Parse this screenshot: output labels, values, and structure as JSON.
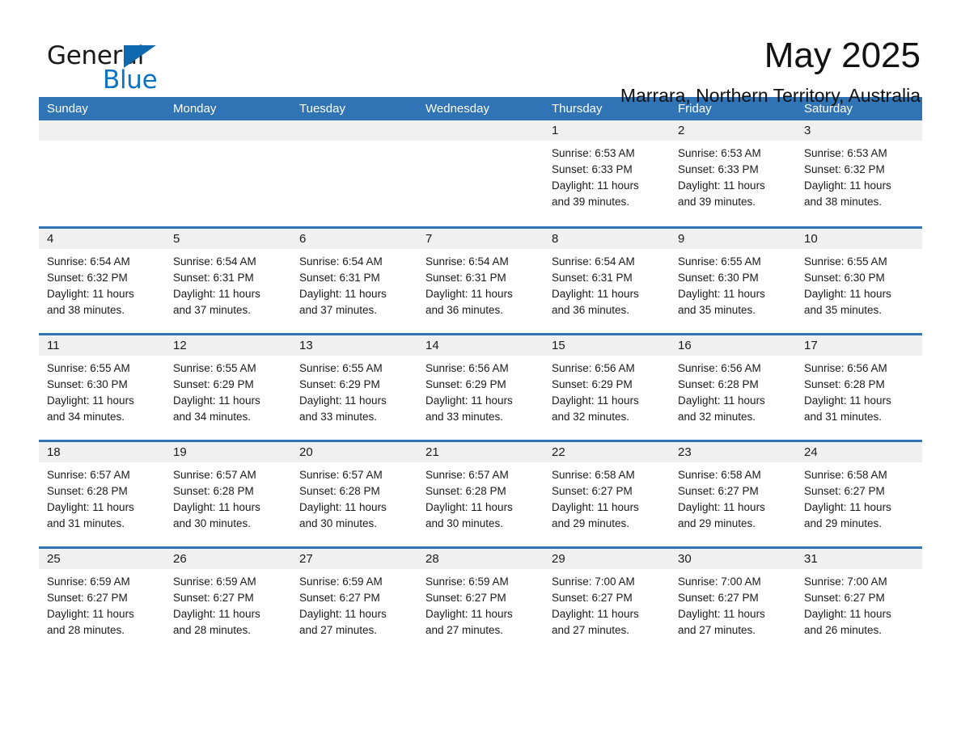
{
  "brand": {
    "name_part1": "General",
    "name_part2": "Blue",
    "triangle_icon": "brand-triangle-icon",
    "accent_color": "#1069ae",
    "blue_text_color": "#0b72c4"
  },
  "header": {
    "month_title": "May 2025",
    "location": "Marrara, Northern Territory, Australia",
    "header_bar_color": "#3174b6",
    "day_number_band_color": "#f0f0f0"
  },
  "weekdays": [
    "Sunday",
    "Monday",
    "Tuesday",
    "Wednesday",
    "Thursday",
    "Friday",
    "Saturday"
  ],
  "labels": {
    "sunrise_prefix": "Sunrise:",
    "sunset_prefix": "Sunset:",
    "daylight_prefix": "Daylight:"
  },
  "weeks": [
    [
      {
        "day": "",
        "empty": true
      },
      {
        "day": "",
        "empty": true
      },
      {
        "day": "",
        "empty": true
      },
      {
        "day": "",
        "empty": true
      },
      {
        "day": "1",
        "sunrise": "Sunrise: 6:53 AM",
        "sunset": "Sunset: 6:33 PM",
        "daylight_l1": "Daylight: 11 hours",
        "daylight_l2": "and 39 minutes."
      },
      {
        "day": "2",
        "sunrise": "Sunrise: 6:53 AM",
        "sunset": "Sunset: 6:33 PM",
        "daylight_l1": "Daylight: 11 hours",
        "daylight_l2": "and 39 minutes."
      },
      {
        "day": "3",
        "sunrise": "Sunrise: 6:53 AM",
        "sunset": "Sunset: 6:32 PM",
        "daylight_l1": "Daylight: 11 hours",
        "daylight_l2": "and 38 minutes."
      }
    ],
    [
      {
        "day": "4",
        "sunrise": "Sunrise: 6:54 AM",
        "sunset": "Sunset: 6:32 PM",
        "daylight_l1": "Daylight: 11 hours",
        "daylight_l2": "and 38 minutes."
      },
      {
        "day": "5",
        "sunrise": "Sunrise: 6:54 AM",
        "sunset": "Sunset: 6:31 PM",
        "daylight_l1": "Daylight: 11 hours",
        "daylight_l2": "and 37 minutes."
      },
      {
        "day": "6",
        "sunrise": "Sunrise: 6:54 AM",
        "sunset": "Sunset: 6:31 PM",
        "daylight_l1": "Daylight: 11 hours",
        "daylight_l2": "and 37 minutes."
      },
      {
        "day": "7",
        "sunrise": "Sunrise: 6:54 AM",
        "sunset": "Sunset: 6:31 PM",
        "daylight_l1": "Daylight: 11 hours",
        "daylight_l2": "and 36 minutes."
      },
      {
        "day": "8",
        "sunrise": "Sunrise: 6:54 AM",
        "sunset": "Sunset: 6:31 PM",
        "daylight_l1": "Daylight: 11 hours",
        "daylight_l2": "and 36 minutes."
      },
      {
        "day": "9",
        "sunrise": "Sunrise: 6:55 AM",
        "sunset": "Sunset: 6:30 PM",
        "daylight_l1": "Daylight: 11 hours",
        "daylight_l2": "and 35 minutes."
      },
      {
        "day": "10",
        "sunrise": "Sunrise: 6:55 AM",
        "sunset": "Sunset: 6:30 PM",
        "daylight_l1": "Daylight: 11 hours",
        "daylight_l2": "and 35 minutes."
      }
    ],
    [
      {
        "day": "11",
        "sunrise": "Sunrise: 6:55 AM",
        "sunset": "Sunset: 6:30 PM",
        "daylight_l1": "Daylight: 11 hours",
        "daylight_l2": "and 34 minutes."
      },
      {
        "day": "12",
        "sunrise": "Sunrise: 6:55 AM",
        "sunset": "Sunset: 6:29 PM",
        "daylight_l1": "Daylight: 11 hours",
        "daylight_l2": "and 34 minutes."
      },
      {
        "day": "13",
        "sunrise": "Sunrise: 6:55 AM",
        "sunset": "Sunset: 6:29 PM",
        "daylight_l1": "Daylight: 11 hours",
        "daylight_l2": "and 33 minutes."
      },
      {
        "day": "14",
        "sunrise": "Sunrise: 6:56 AM",
        "sunset": "Sunset: 6:29 PM",
        "daylight_l1": "Daylight: 11 hours",
        "daylight_l2": "and 33 minutes."
      },
      {
        "day": "15",
        "sunrise": "Sunrise: 6:56 AM",
        "sunset": "Sunset: 6:29 PM",
        "daylight_l1": "Daylight: 11 hours",
        "daylight_l2": "and 32 minutes."
      },
      {
        "day": "16",
        "sunrise": "Sunrise: 6:56 AM",
        "sunset": "Sunset: 6:28 PM",
        "daylight_l1": "Daylight: 11 hours",
        "daylight_l2": "and 32 minutes."
      },
      {
        "day": "17",
        "sunrise": "Sunrise: 6:56 AM",
        "sunset": "Sunset: 6:28 PM",
        "daylight_l1": "Daylight: 11 hours",
        "daylight_l2": "and 31 minutes."
      }
    ],
    [
      {
        "day": "18",
        "sunrise": "Sunrise: 6:57 AM",
        "sunset": "Sunset: 6:28 PM",
        "daylight_l1": "Daylight: 11 hours",
        "daylight_l2": "and 31 minutes."
      },
      {
        "day": "19",
        "sunrise": "Sunrise: 6:57 AM",
        "sunset": "Sunset: 6:28 PM",
        "daylight_l1": "Daylight: 11 hours",
        "daylight_l2": "and 30 minutes."
      },
      {
        "day": "20",
        "sunrise": "Sunrise: 6:57 AM",
        "sunset": "Sunset: 6:28 PM",
        "daylight_l1": "Daylight: 11 hours",
        "daylight_l2": "and 30 minutes."
      },
      {
        "day": "21",
        "sunrise": "Sunrise: 6:57 AM",
        "sunset": "Sunset: 6:28 PM",
        "daylight_l1": "Daylight: 11 hours",
        "daylight_l2": "and 30 minutes."
      },
      {
        "day": "22",
        "sunrise": "Sunrise: 6:58 AM",
        "sunset": "Sunset: 6:27 PM",
        "daylight_l1": "Daylight: 11 hours",
        "daylight_l2": "and 29 minutes."
      },
      {
        "day": "23",
        "sunrise": "Sunrise: 6:58 AM",
        "sunset": "Sunset: 6:27 PM",
        "daylight_l1": "Daylight: 11 hours",
        "daylight_l2": "and 29 minutes."
      },
      {
        "day": "24",
        "sunrise": "Sunrise: 6:58 AM",
        "sunset": "Sunset: 6:27 PM",
        "daylight_l1": "Daylight: 11 hours",
        "daylight_l2": "and 29 minutes."
      }
    ],
    [
      {
        "day": "25",
        "sunrise": "Sunrise: 6:59 AM",
        "sunset": "Sunset: 6:27 PM",
        "daylight_l1": "Daylight: 11 hours",
        "daylight_l2": "and 28 minutes."
      },
      {
        "day": "26",
        "sunrise": "Sunrise: 6:59 AM",
        "sunset": "Sunset: 6:27 PM",
        "daylight_l1": "Daylight: 11 hours",
        "daylight_l2": "and 28 minutes."
      },
      {
        "day": "27",
        "sunrise": "Sunrise: 6:59 AM",
        "sunset": "Sunset: 6:27 PM",
        "daylight_l1": "Daylight: 11 hours",
        "daylight_l2": "and 27 minutes."
      },
      {
        "day": "28",
        "sunrise": "Sunrise: 6:59 AM",
        "sunset": "Sunset: 6:27 PM",
        "daylight_l1": "Daylight: 11 hours",
        "daylight_l2": "and 27 minutes."
      },
      {
        "day": "29",
        "sunrise": "Sunrise: 7:00 AM",
        "sunset": "Sunset: 6:27 PM",
        "daylight_l1": "Daylight: 11 hours",
        "daylight_l2": "and 27 minutes."
      },
      {
        "day": "30",
        "sunrise": "Sunrise: 7:00 AM",
        "sunset": "Sunset: 6:27 PM",
        "daylight_l1": "Daylight: 11 hours",
        "daylight_l2": "and 27 minutes."
      },
      {
        "day": "31",
        "sunrise": "Sunrise: 7:00 AM",
        "sunset": "Sunset: 6:27 PM",
        "daylight_l1": "Daylight: 11 hours",
        "daylight_l2": "and 26 minutes."
      }
    ]
  ]
}
